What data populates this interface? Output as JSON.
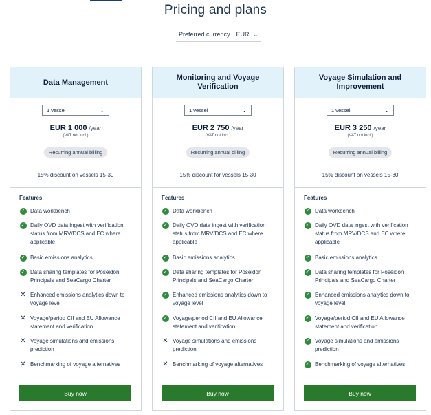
{
  "page": {
    "title": "Pricing and plans"
  },
  "currency": {
    "label": "Preferred currency",
    "value": "EUR"
  },
  "plans": [
    {
      "name": "Data Management",
      "vessel_select": "1 vessel",
      "price": "EUR 1 000",
      "period": "/year",
      "vat": "(VAT not incl.)",
      "billing": "Recurring annual billing",
      "discount": "15% discount on vessels 15-30",
      "features_title": "Features",
      "features": [
        {
          "text": "Data workbench",
          "included": true
        },
        {
          "text": "Daily OVD data ingest with verification status from MRV/DCS and EC where applicable",
          "included": true
        },
        {
          "text": "Basic emissions analytics",
          "included": true
        },
        {
          "text": "Data sharing templates for Poseidon Principals and SeaCargo Charter",
          "included": true
        },
        {
          "text": "Enhanced emissions analytics down to voyage level",
          "included": false
        },
        {
          "text": "Voyage/period CII and EU Allowance statement and verification",
          "included": false
        },
        {
          "text": "Voyage simulations and emissions prediction",
          "included": false
        },
        {
          "text": "Benchmarking of voyage alternatives",
          "included": false
        }
      ],
      "buy_label": "Buy now"
    },
    {
      "name": "Monitoring and Voyage Verification",
      "vessel_select": "1 vessel",
      "price": "EUR 2 750",
      "period": "/year",
      "vat": "(VAT not incl.)",
      "billing": "Recurring annual billing",
      "discount": "15% discount for vessels 15-30",
      "features_title": "Features",
      "features": [
        {
          "text": "Data workbench",
          "included": true
        },
        {
          "text": "Daily OVD data ingest with verification status from MRV/DCS and EC where applicable",
          "included": true
        },
        {
          "text": "Basic emissions analytics",
          "included": true
        },
        {
          "text": "Data sharing templates for Poseidon Principals and SeaCargo Charter",
          "included": true
        },
        {
          "text": "Enhanced emissions analytics down to voyage level",
          "included": true
        },
        {
          "text": "Voyage/period CII and EU Allowance statement and verification",
          "included": true
        },
        {
          "text": "Voyage simulations and emissions prediction",
          "included": false
        },
        {
          "text": "Benchmarking of voyage alternatives",
          "included": false
        }
      ],
      "buy_label": "Buy now"
    },
    {
      "name": "Voyage Simulation and Improvement",
      "vessel_select": "1 vessel",
      "price": "EUR 3 250",
      "period": "/year",
      "vat": "(VAT not incl.)",
      "billing": "Recurring annual billing",
      "discount": "15% discount on vessels 15-30",
      "features_title": "Features",
      "features": [
        {
          "text": "Data workbench",
          "included": true
        },
        {
          "text": "Daily OVD data ingest with verification status from MRV/DCS and EC where applicable",
          "included": true
        },
        {
          "text": "Basic emissions analytics",
          "included": true
        },
        {
          "text": "Data sharing templates for Poseidon Principals and SeaCargo Charter",
          "included": true
        },
        {
          "text": "Enhanced emissions analytics down to voyage level",
          "included": true
        },
        {
          "text": "Voyage/period CII and EU Allowance statement and verification",
          "included": true
        },
        {
          "text": "Voyage simulations and emissions prediction",
          "included": true
        },
        {
          "text": "Benchmarking of voyage alternatives",
          "included": true
        }
      ],
      "buy_label": "Buy now"
    }
  ],
  "colors": {
    "header_bg": "#e2f2fa",
    "buy_button": "#2a7a2e",
    "check": "#2e8b3d",
    "text": "#1f3550"
  },
  "icons": {
    "included": "check-circle-icon",
    "excluded": "x-icon",
    "dropdown": "chevron-down-icon"
  }
}
